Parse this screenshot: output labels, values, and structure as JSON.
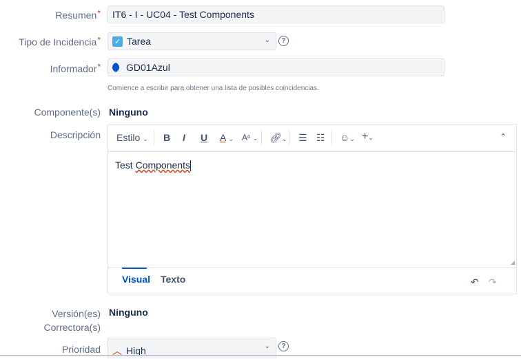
{
  "resumen": {
    "label": "Resumen",
    "value": "IT6 - I - UC04 - Test Components"
  },
  "tipo": {
    "label": "Tipo de Incidencia",
    "value": "Tarea"
  },
  "informador": {
    "label": "Informador",
    "value": "GD01Azul",
    "hint": "Comience a escribir para obtener una lista de posibles coincidencias."
  },
  "componentes": {
    "label": "Componente(s)",
    "value": "Ninguno"
  },
  "descripcion": {
    "label": "Descripción",
    "toolbar": {
      "style": "Estilo",
      "bold": "B",
      "italic": "I",
      "underline": "U",
      "color": "A",
      "more": "A"
    },
    "content_prefix": "Test ",
    "content_word": "Components",
    "tabs": {
      "visual": "Visual",
      "texto": "Texto"
    }
  },
  "version": {
    "label_line1": "Versión(es)",
    "label_line2": "Correctora(s)",
    "value": "Ninguno"
  },
  "prioridad": {
    "label": "Prioridad",
    "value": "High"
  },
  "required_mark": "*",
  "help_glyph": "?"
}
